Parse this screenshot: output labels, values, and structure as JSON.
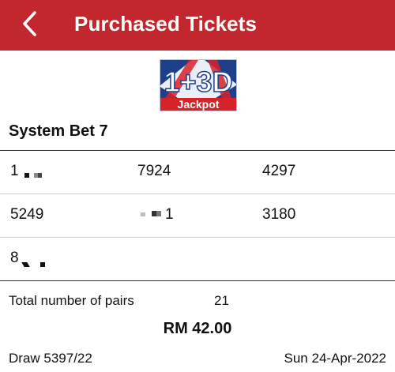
{
  "header": {
    "title": "Purchased Tickets",
    "back_icon": "chevron-left-icon",
    "bg_color": "#c1272d"
  },
  "logo": {
    "top_text": "1+3D",
    "bottom_text": "Jackpot"
  },
  "bet": {
    "title": "System Bet 7",
    "numbers": [
      [
        "1",
        "7924",
        "4297"
      ],
      [
        "5249",
        "1",
        "3180"
      ],
      [
        "8",
        "",
        ""
      ]
    ]
  },
  "summary": {
    "pairs_label": "Total number of pairs",
    "pairs_value": "21",
    "total": "RM 42.00",
    "draw": "Draw 5397/22",
    "date": "Sun 24-Apr-2022"
  }
}
